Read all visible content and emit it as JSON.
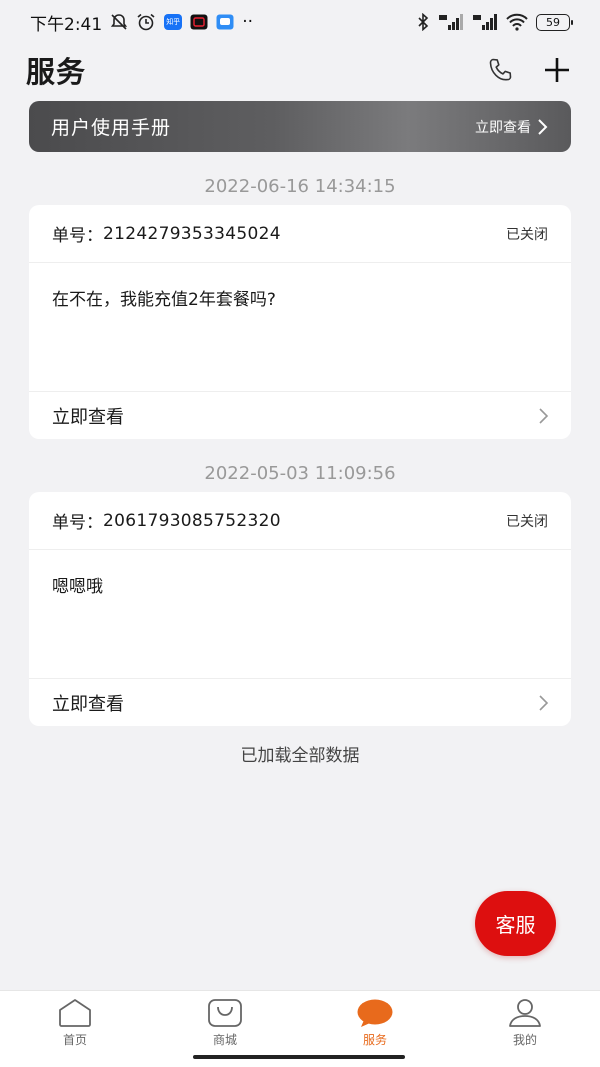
{
  "status_bar": {
    "time": "下午2:41",
    "app_zhihu": "知乎",
    "more": "··",
    "battery": "59"
  },
  "header": {
    "title": "服务"
  },
  "manual_banner": {
    "title": "用户使用手册",
    "link": "立即查看"
  },
  "tickets": [
    {
      "timestamp": "2022-06-16 14:34:15",
      "no_label": "单号：",
      "no": "2124279353345024",
      "status": "已关闭",
      "content": "在不在，我能充值2年套餐吗?",
      "view": "立即查看"
    },
    {
      "timestamp": "2022-05-03 11:09:56",
      "no_label": "单号：",
      "no": "2061793085752320",
      "status": "已关闭",
      "content": "嗯嗯哦",
      "view": "立即查看"
    }
  ],
  "loaded_all": "已加载全部数据",
  "cs_button": "客服",
  "nav": {
    "items": [
      {
        "label": "首页",
        "icon": "home-icon"
      },
      {
        "label": "商城",
        "icon": "shop-bag-icon"
      },
      {
        "label": "服务",
        "icon": "service-chat-icon"
      },
      {
        "label": "我的",
        "icon": "profile-icon"
      }
    ],
    "active_color": "#e86a1c"
  },
  "colors": {
    "accent": "#e86a1c",
    "cs_red": "#dd0f0f",
    "background": "#f2f2f4"
  }
}
